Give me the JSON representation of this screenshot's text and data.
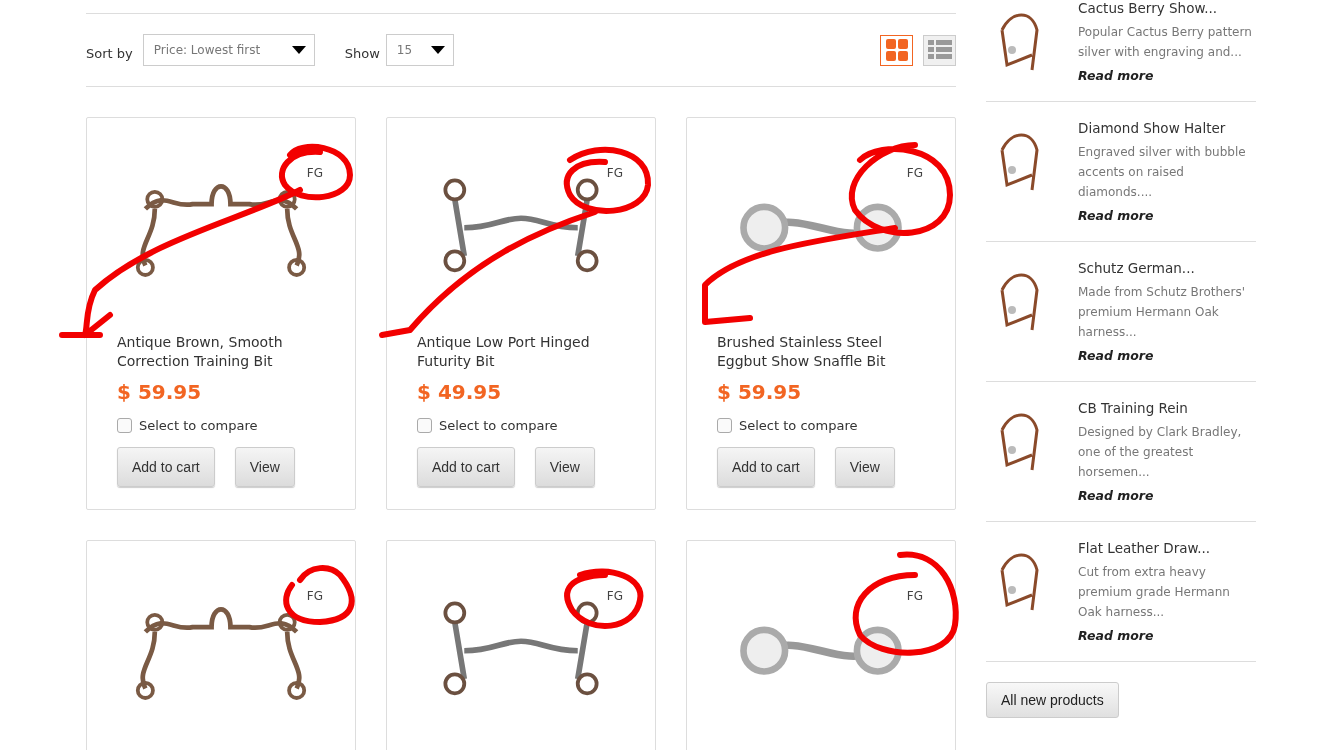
{
  "toolbar": {
    "sort_label": "Sort by",
    "sort_value": "Price: Lowest first",
    "show_label": "Show",
    "show_value": "15",
    "views": [
      {
        "kind": "grid",
        "selected": true
      },
      {
        "kind": "list",
        "selected": false
      }
    ]
  },
  "products": [
    {
      "badge": "FG",
      "name": "Antique Brown, Smooth Correction Training Bit",
      "price": "$ 59.95",
      "compare_label": "Select to compare",
      "checked": false,
      "buttons": [
        "Add to cart",
        "View"
      ]
    },
    {
      "badge": "FG",
      "name": "Antique Low Port Hinged Futurity Bit",
      "price": "$ 49.95",
      "compare_label": "Select to compare",
      "checked": false,
      "buttons": [
        "Add to cart",
        "View"
      ]
    },
    {
      "badge": "FG",
      "name": "Brushed Stainless Steel Eggbut Show Snaffle Bit",
      "price": "$ 59.95",
      "compare_label": "Select to compare",
      "checked": false,
      "buttons": [
        "Add to cart",
        "View"
      ]
    },
    {
      "badge": "FG"
    },
    {
      "badge": "FG"
    },
    {
      "badge": "FG"
    }
  ],
  "sidebar": {
    "items": [
      {
        "title": "Cactus Berry Show...",
        "description": "Popular Cactus Berry pattern silver with engraving and...",
        "link": "Read more"
      },
      {
        "title": "Diamond Show Halter",
        "description": "Engraved silver with bubble accents on raised diamonds....",
        "link": "Read more"
      },
      {
        "title": "Schutz German...",
        "description": "Made from Schutz Brothers' premium Hermann Oak harness...",
        "link": "Read more"
      },
      {
        "title": "CB Training Rein",
        "description": "Designed by Clark Bradley, one of the greatest horsemen...",
        "link": "Read more"
      },
      {
        "title": "Flat Leather Draw...",
        "description": "Cut from extra heavy premium grade Hermann Oak harness...",
        "link": "Read more"
      }
    ],
    "button": "All new products"
  }
}
